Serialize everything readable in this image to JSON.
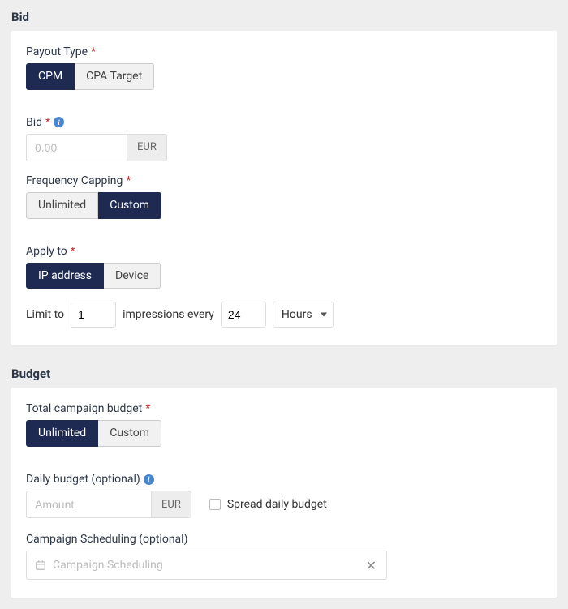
{
  "bid_section": {
    "title": "Bid",
    "payout_type": {
      "label": "Payout Type",
      "options": {
        "cpm": "CPM",
        "cpa": "CPA Target"
      },
      "selected": "cpm"
    },
    "bid": {
      "label": "Bid",
      "placeholder": "0.00",
      "currency": "EUR",
      "value": ""
    },
    "frequency_capping": {
      "label": "Frequency Capping",
      "options": {
        "unlimited": "Unlimited",
        "custom": "Custom"
      },
      "selected": "custom"
    },
    "apply_to": {
      "label": "Apply to",
      "options": {
        "ip": "IP address",
        "device": "Device"
      },
      "selected": "ip"
    },
    "limit": {
      "prefix": "Limit to",
      "count": "1",
      "mid": "impressions every",
      "interval": "24",
      "unit": "Hours"
    }
  },
  "budget_section": {
    "title": "Budget",
    "total_budget": {
      "label": "Total campaign budget",
      "options": {
        "unlimited": "Unlimited",
        "custom": "Custom"
      },
      "selected": "unlimited"
    },
    "daily_budget": {
      "label": "Daily budget (optional)",
      "placeholder": "Amount",
      "currency": "EUR",
      "value": "",
      "spread_label": "Spread daily budget",
      "spread_checked": false
    },
    "scheduling": {
      "label": "Campaign Scheduling (optional)",
      "placeholder": "Campaign Scheduling"
    }
  }
}
